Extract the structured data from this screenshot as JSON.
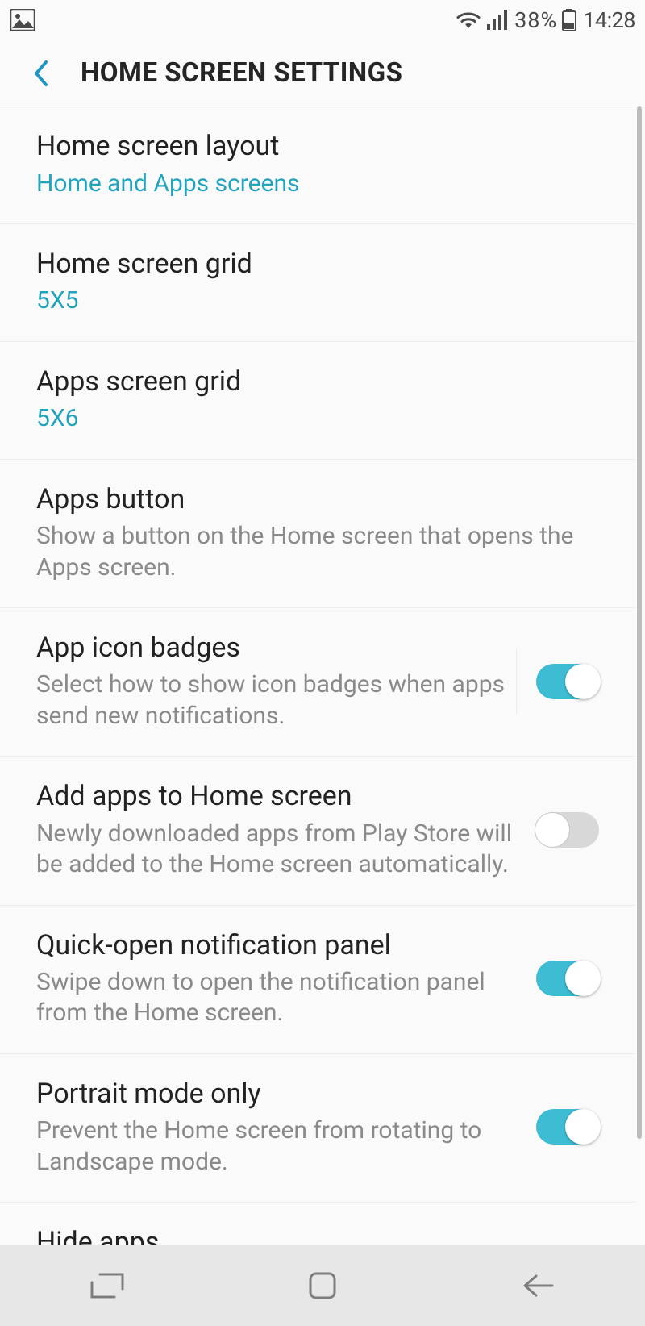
{
  "status": {
    "battery_pct": "38%",
    "time": "14:28"
  },
  "header": {
    "title": "HOME SCREEN SETTINGS"
  },
  "items": [
    {
      "title": "Home screen layout",
      "sub": "Home and Apps screens",
      "accent": true,
      "toggle": null
    },
    {
      "title": "Home screen grid",
      "sub": "5X5",
      "accent": true,
      "toggle": null
    },
    {
      "title": "Apps screen grid",
      "sub": "5X6",
      "accent": true,
      "toggle": null
    },
    {
      "title": "Apps button",
      "sub": "Show a button on the Home screen that opens the Apps screen.",
      "accent": false,
      "toggle": null
    },
    {
      "title": "App icon badges",
      "sub": "Select how to show icon badges when apps send new notifications.",
      "accent": false,
      "toggle": true,
      "divider": true
    },
    {
      "title": "Add apps to Home screen",
      "sub": "Newly downloaded apps from Play Store will be added to the Home screen automatically.",
      "accent": false,
      "toggle": false
    },
    {
      "title": "Quick-open notification panel",
      "sub": "Swipe down to open the notification panel from the Home screen.",
      "accent": false,
      "toggle": true
    },
    {
      "title": "Portrait mode only",
      "sub": "Prevent the Home screen from rotating to Landscape mode.",
      "accent": false,
      "toggle": true
    },
    {
      "title": "Hide apps",
      "sub": "",
      "accent": false,
      "toggle": null
    }
  ]
}
